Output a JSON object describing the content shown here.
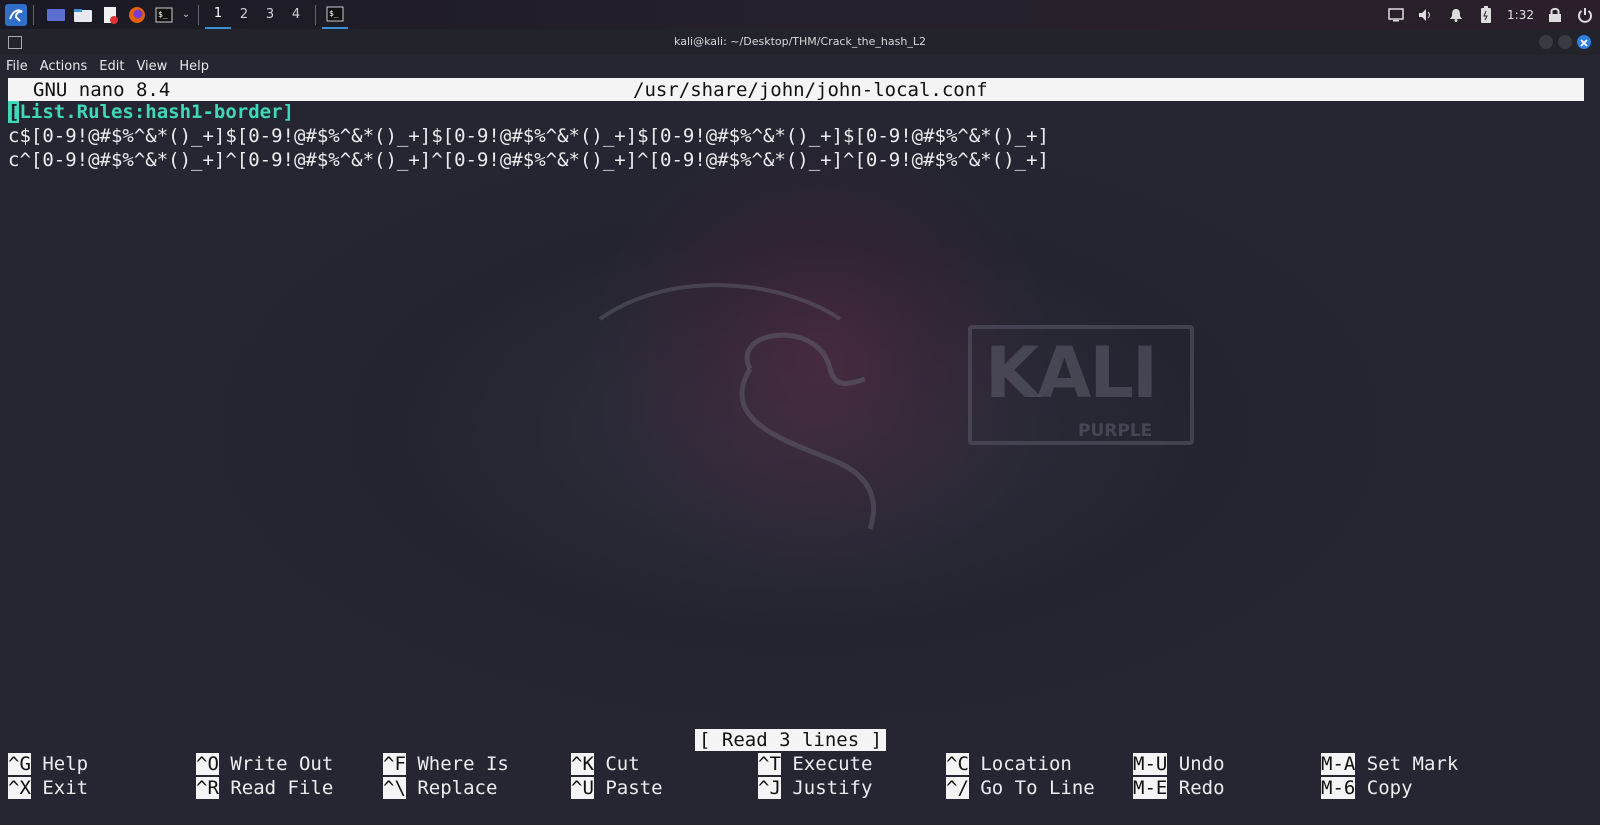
{
  "taskbar": {
    "workspaces": [
      "1",
      "2",
      "3",
      "4"
    ],
    "active_workspace": "1",
    "clock": "1:32"
  },
  "window": {
    "title": "kali@kali: ~/Desktop/THM/Crack_the_hash_L2",
    "menu": [
      "File",
      "Actions",
      "Edit",
      "View",
      "Help"
    ]
  },
  "nano": {
    "version": "GNU nano 8.4",
    "filename": "/usr/share/john/john-local.conf",
    "lines": [
      {
        "cursor": "[",
        "rest": "List.Rules:hash1-border]"
      },
      "c$[0-9!@#$%^&*()_+]$[0-9!@#$%^&*()_+]$[0-9!@#$%^&*()_+]$[0-9!@#$%^&*()_+]$[0-9!@#$%^&*()_+]",
      "c^[0-9!@#$%^&*()_+]^[0-9!@#$%^&*()_+]^[0-9!@#$%^&*()_+]^[0-9!@#$%^&*()_+]^[0-9!@#$%^&*()_+]"
    ],
    "status": "[ Read 3 lines ]",
    "shortcuts": [
      [
        {
          "key": "^G",
          "label": "Help"
        },
        {
          "key": "^X",
          "label": "Exit"
        }
      ],
      [
        {
          "key": "^O",
          "label": "Write Out"
        },
        {
          "key": "^R",
          "label": "Read File"
        }
      ],
      [
        {
          "key": "^F",
          "label": "Where Is"
        },
        {
          "key": "^\\",
          "label": "Replace"
        }
      ],
      [
        {
          "key": "^K",
          "label": "Cut"
        },
        {
          "key": "^U",
          "label": "Paste"
        }
      ],
      [
        {
          "key": "^T",
          "label": "Execute"
        },
        {
          "key": "^J",
          "label": "Justify"
        }
      ],
      [
        {
          "key": "^C",
          "label": "Location"
        },
        {
          "key": "^/",
          "label": "Go To Line"
        }
      ],
      [
        {
          "key": "M-U",
          "label": "Undo"
        },
        {
          "key": "M-E",
          "label": "Redo"
        }
      ],
      [
        {
          "key": "M-A",
          "label": "Set Mark"
        },
        {
          "key": "M-6",
          "label": "Copy"
        }
      ]
    ]
  },
  "wallpaper": {
    "brand": "KALI",
    "edition": "PURPLE"
  }
}
